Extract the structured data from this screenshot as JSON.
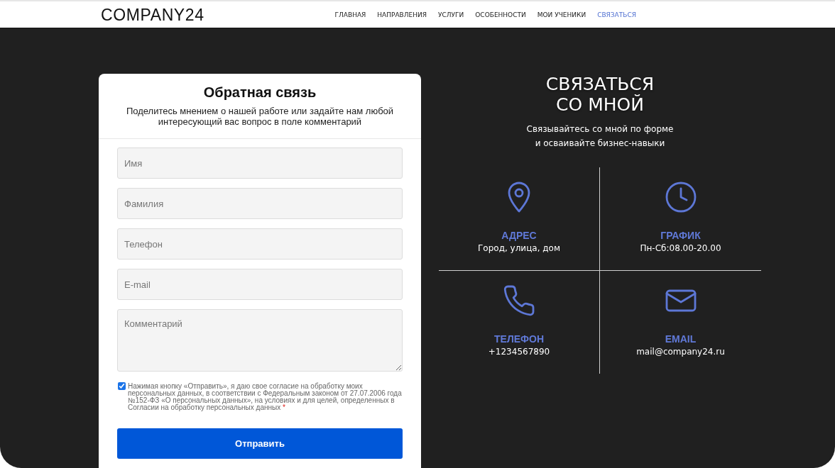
{
  "header": {
    "logo": "COMPANY24",
    "nav": [
      {
        "label": "ГЛАВНАЯ",
        "selected": false
      },
      {
        "label": "НАПРАВЛЕНИЯ",
        "selected": false
      },
      {
        "label": "УСЛУГИ",
        "selected": false
      },
      {
        "label": "ОСОБЕННОСТИ",
        "selected": false
      },
      {
        "label": "МОИ УЧЕНИКИ",
        "selected": false
      },
      {
        "label": "СВЯЗАТЬСЯ",
        "selected": true
      }
    ]
  },
  "form": {
    "title": "Обратная связь",
    "subtitle": "Поделитесь мнением о нашей работе или задайте нам любой интересующий вас вопрос в поле комментарий",
    "fields": [
      {
        "kind": "input",
        "placeholder": "Имя"
      },
      {
        "kind": "input",
        "placeholder": "Фамилия"
      },
      {
        "kind": "input",
        "placeholder": "Телефон"
      },
      {
        "kind": "input",
        "placeholder": "E-mail"
      },
      {
        "kind": "textarea",
        "placeholder": "Комментарий"
      }
    ],
    "consent": {
      "checked": true,
      "text": "Нажимая кнопку «Отправить», я даю свое согласие на обработку моих персональных данных, в соответствии с Федеральным законом от 27.07.2006 года №152-ФЗ «О персональных данных», на условиях и для целей, определенных в Согласии на обработку персональных данных",
      "required_mark": "*"
    },
    "submit": "Отправить"
  },
  "contact": {
    "title": "СВЯЗАТЬСЯ СО МНОЙ",
    "subtitle": "Связывайтесь со мной по форме и осваивайте бизнес-навыки",
    "items": [
      {
        "kind": "address",
        "label": "АДРЕС",
        "value": "Город, улица, дом"
      },
      {
        "kind": "schedule",
        "label": "ГРАФИК",
        "value": "Пн-Сб:08.00-20.00"
      },
      {
        "kind": "phone",
        "label": "ТЕЛЕФОН",
        "value": "+1234567890"
      },
      {
        "kind": "email",
        "label": "EMAIL",
        "value": "mail@company24.ru"
      }
    ]
  }
}
